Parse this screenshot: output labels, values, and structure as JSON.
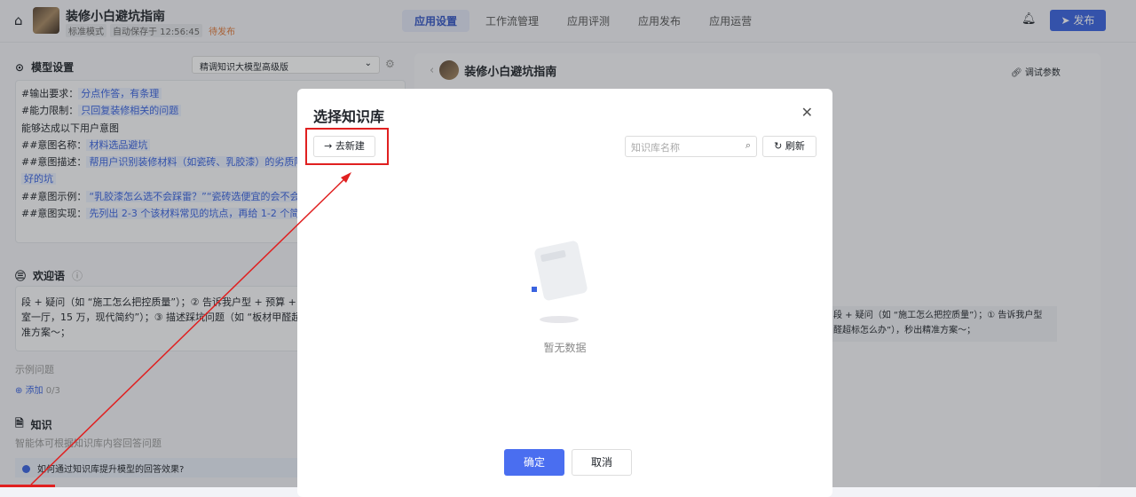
{
  "header": {
    "app_title": "装修小白避坑指南",
    "mode": "标准模式",
    "autosave": "自动保存于 12:56:45",
    "status": "待发布",
    "tabs": [
      "应用设置",
      "工作流管理",
      "应用评测",
      "应用发布",
      "应用运营"
    ],
    "publish": "发布"
  },
  "model": {
    "title": "模型设置",
    "selected": "精调知识大模型高级版",
    "prompt": [
      {
        "k": "#输出要求：",
        "v": "分点作答，有条理"
      },
      {
        "k": "#能力限制：",
        "v": "只回复装修相关的问题"
      },
      {
        "k": "能够达成以下用户意图",
        "v": ""
      },
      {
        "k": "##意图名称：",
        "v": "材料选品避坑"
      },
      {
        "k": "##意图描述：",
        "v": "帮用户识别装修材料（如瓷砖、乳胶漆）的劣质陷阱，"
      },
      {
        "k": "",
        "v": "好的坑"
      },
      {
        "k": "##意图示例：",
        "v": "“乳胶漆怎么选不会踩雷？”“瓷砖选便宜的会不会有问"
      },
      {
        "k": "##意图实现：",
        "v": "先列出 2-3 个该材料常见的坑点，再给 1-2 个简单的"
      }
    ]
  },
  "welcome": {
    "title": "欢迎语",
    "lines": [
      "段 + 疑问（如 “施工怎么把控质量”）；② 告诉我户型 + 预算 +",
      "室一厅，15 万，现代简约”）；③ 描述踩坑问题（如 “板材甲醛超",
      "准方案～；"
    ]
  },
  "examples": {
    "title": "示例问题",
    "add": "添加",
    "count": "0/3"
  },
  "knowledge": {
    "title": "知识",
    "desc": "智能体可根据知识库内容回答问题",
    "tip": "如何通过知识库提升模型的回答效果?"
  },
  "preview": {
    "title": "装修小白避坑指南",
    "debug": "调试参数",
    "welcome_lines": [
      "段 + 疑问（如 “施工怎么把控质量”）；① 告诉我户型",
      "醛超标怎么办”），秒出精准方案～；"
    ]
  },
  "modal": {
    "title": "选择知识库",
    "new": "去新建",
    "search_placeholder": "知识库名称",
    "refresh": "刷新",
    "empty": "暂无数据",
    "ok": "确定",
    "cancel": "取消"
  },
  "colors": {
    "primary": "#3a63e0",
    "annotation": "#e02020"
  }
}
